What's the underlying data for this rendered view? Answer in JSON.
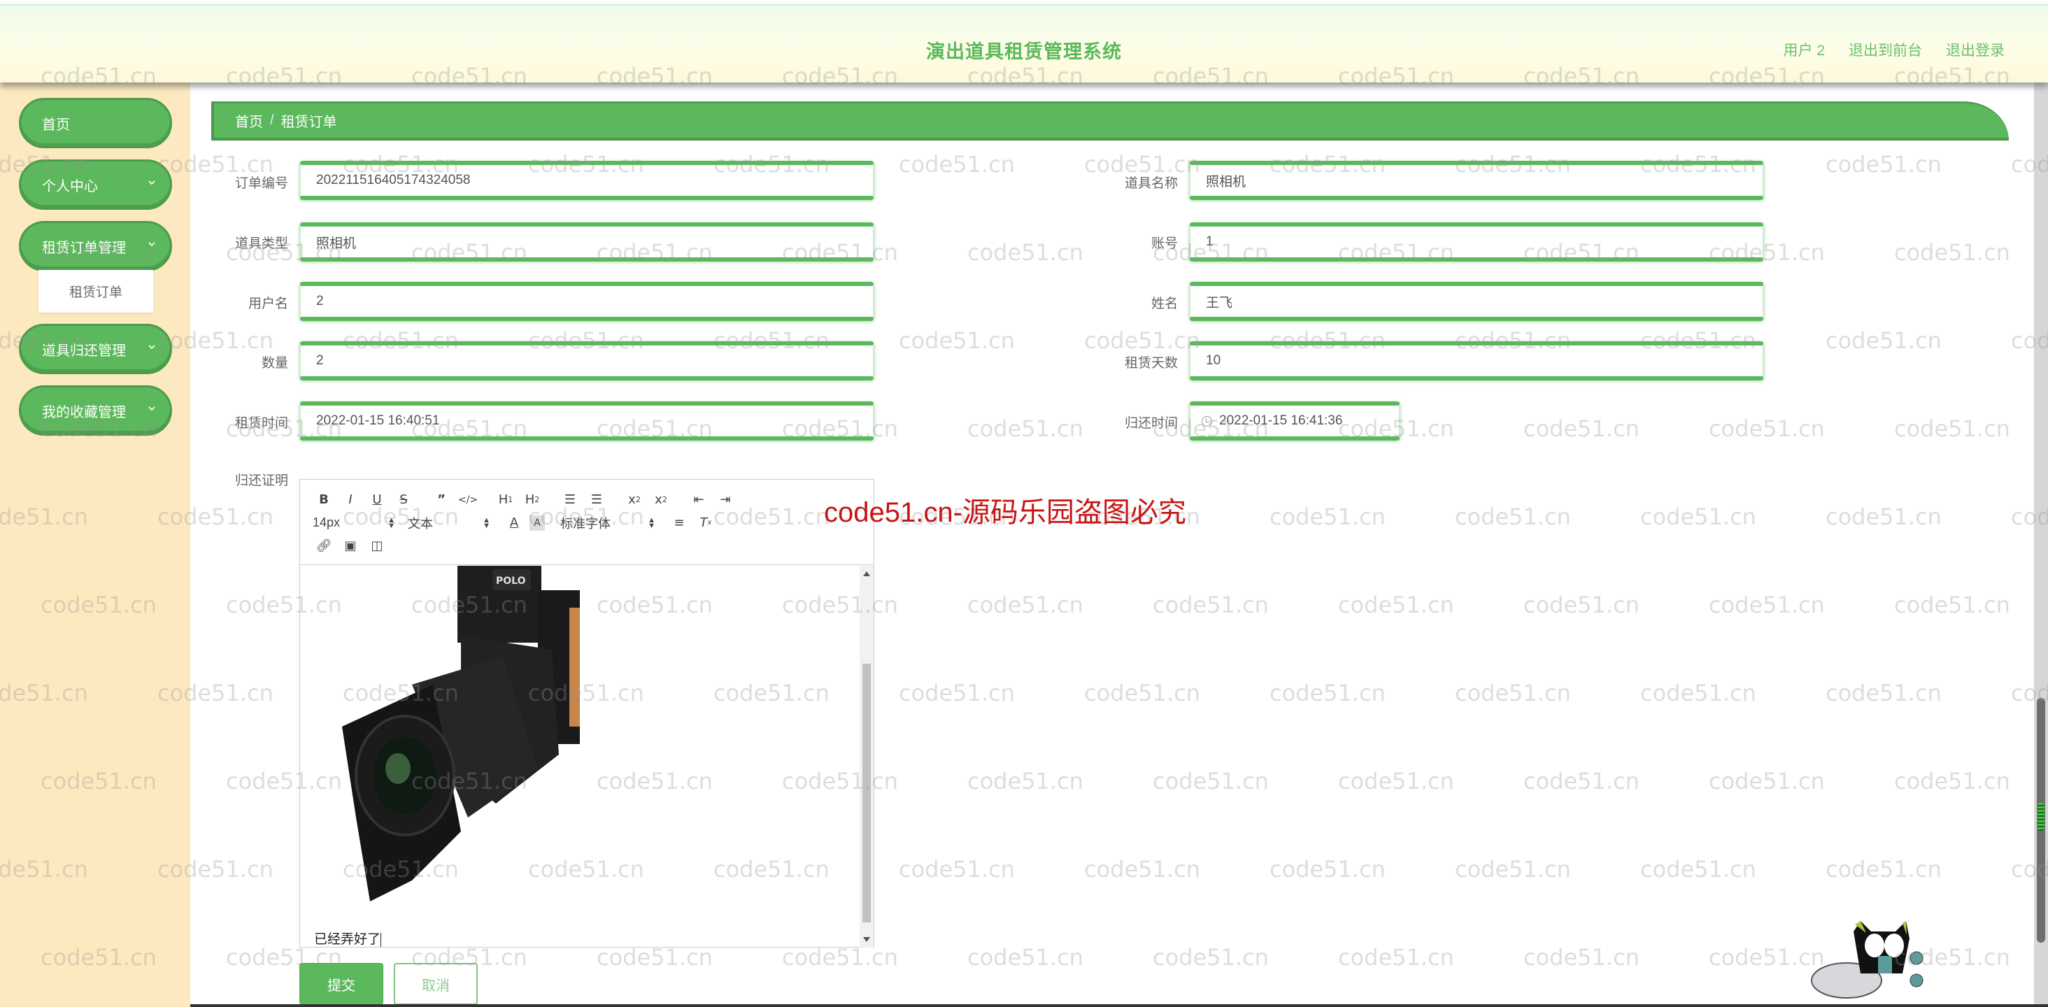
{
  "header": {
    "title": "演出道具租赁管理系统",
    "user_label": "用户 2",
    "front_link": "退出到前台",
    "logout_link": "退出登录"
  },
  "sidebar": {
    "items": [
      {
        "label": "首页",
        "has_children": false
      },
      {
        "label": "个人中心",
        "has_children": true
      },
      {
        "label": "租赁订单管理",
        "has_children": true,
        "expanded": true,
        "children": [
          {
            "label": "租赁订单"
          }
        ]
      },
      {
        "label": "道具归还管理",
        "has_children": true
      },
      {
        "label": "我的收藏管理",
        "has_children": true
      }
    ]
  },
  "breadcrumb": {
    "home": "首页",
    "separator": "/",
    "current": "租赁订单"
  },
  "form": {
    "order_no": {
      "label": "订单编号",
      "value": "20221151640517432405​8"
    },
    "prop_name": {
      "label": "道具名称",
      "value": "照相机"
    },
    "prop_type": {
      "label": "道具类型",
      "value": "照相机"
    },
    "account": {
      "label": "账号",
      "value": "1"
    },
    "username": {
      "label": "用户名",
      "value": "2"
    },
    "real_name": {
      "label": "姓名",
      "value": "王飞"
    },
    "quantity": {
      "label": "数量",
      "value": "2"
    },
    "rent_days": {
      "label": "租赁天数",
      "value": "10"
    },
    "rent_time": {
      "label": "租赁时间",
      "value": "2022-01-15 16:40:51"
    },
    "return_time": {
      "label": "归还时间",
      "value": "2022-01-15 16:41:36"
    },
    "return_proof": {
      "label": "归还证明",
      "content_text": "已经弄好了"
    }
  },
  "editor": {
    "toolbar_row1": [
      "B",
      "I",
      "U",
      "S",
      "❞",
      "</>",
      "H1",
      "H2",
      "ol",
      "ul",
      "x₂",
      "x²",
      "outdent",
      "indent"
    ],
    "font_size": "14px",
    "paragraph": "文本",
    "font_family": "标准字体",
    "image_alt": "camera-photo"
  },
  "buttons": {
    "submit": "提交",
    "cancel": "取消"
  },
  "watermark": {
    "text": "code51.cn",
    "banner": "code51.cn-源码乐园盗图必究"
  },
  "colors": {
    "primary": "#5cb85c",
    "sidebar_bg": "#fde9bf",
    "banner_red": "#c81414"
  }
}
